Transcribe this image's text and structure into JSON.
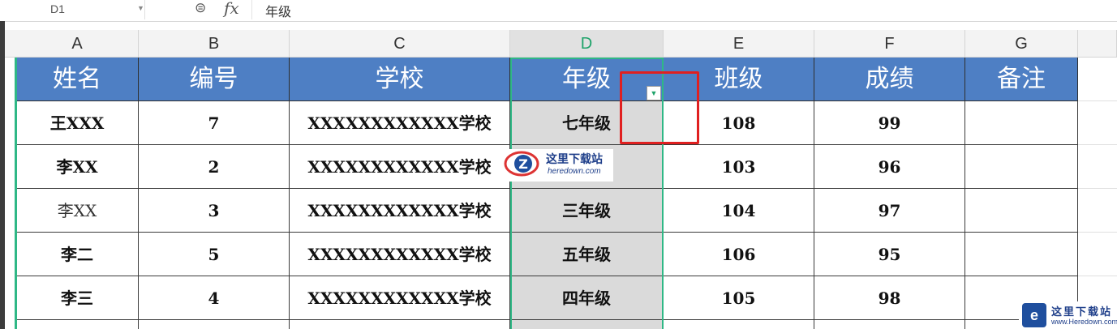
{
  "formula_bar": {
    "cell_ref": "D1",
    "formula": "年级",
    "zoom_icon": "zoom-icon",
    "fx_label": "fx"
  },
  "columns": [
    "A",
    "B",
    "C",
    "D",
    "E",
    "F",
    "G"
  ],
  "selected_column": "D",
  "headers": [
    "姓名",
    "编号",
    "学校",
    "年级",
    "班级",
    "成绩",
    "备注"
  ],
  "rows": [
    {
      "name": "王XXX",
      "id": "7",
      "school": "XXXXXXXXXXXX学校",
      "grade": "七年级",
      "class": "108",
      "score": "99",
      "note": ""
    },
    {
      "name": "李XX",
      "id": "2",
      "school": "XXXXXXXXXXXX学校",
      "grade": "",
      "class": "103",
      "score": "96",
      "note": ""
    },
    {
      "name": "李XX",
      "id": "3",
      "school": "XXXXXXXXXXXX学校",
      "grade": "三年级",
      "class": "104",
      "score": "97",
      "note": ""
    },
    {
      "name": "李二",
      "id": "5",
      "school": "XXXXXXXXXXXX学校",
      "grade": "五年级",
      "class": "106",
      "score": "95",
      "note": ""
    },
    {
      "name": "李三",
      "id": "4",
      "school": "XXXXXXXXXXXX学校",
      "grade": "四年级",
      "class": "105",
      "score": "98",
      "note": ""
    }
  ],
  "watermark": {
    "cn": "这里下载站",
    "en": "heredown.com",
    "corner_cn": "这里下载站",
    "corner_en": "www.Heredown.com"
  },
  "colors": {
    "header_fill": "#4e7fc4",
    "selection": "#2fb886",
    "highlight_box": "#e02020"
  }
}
